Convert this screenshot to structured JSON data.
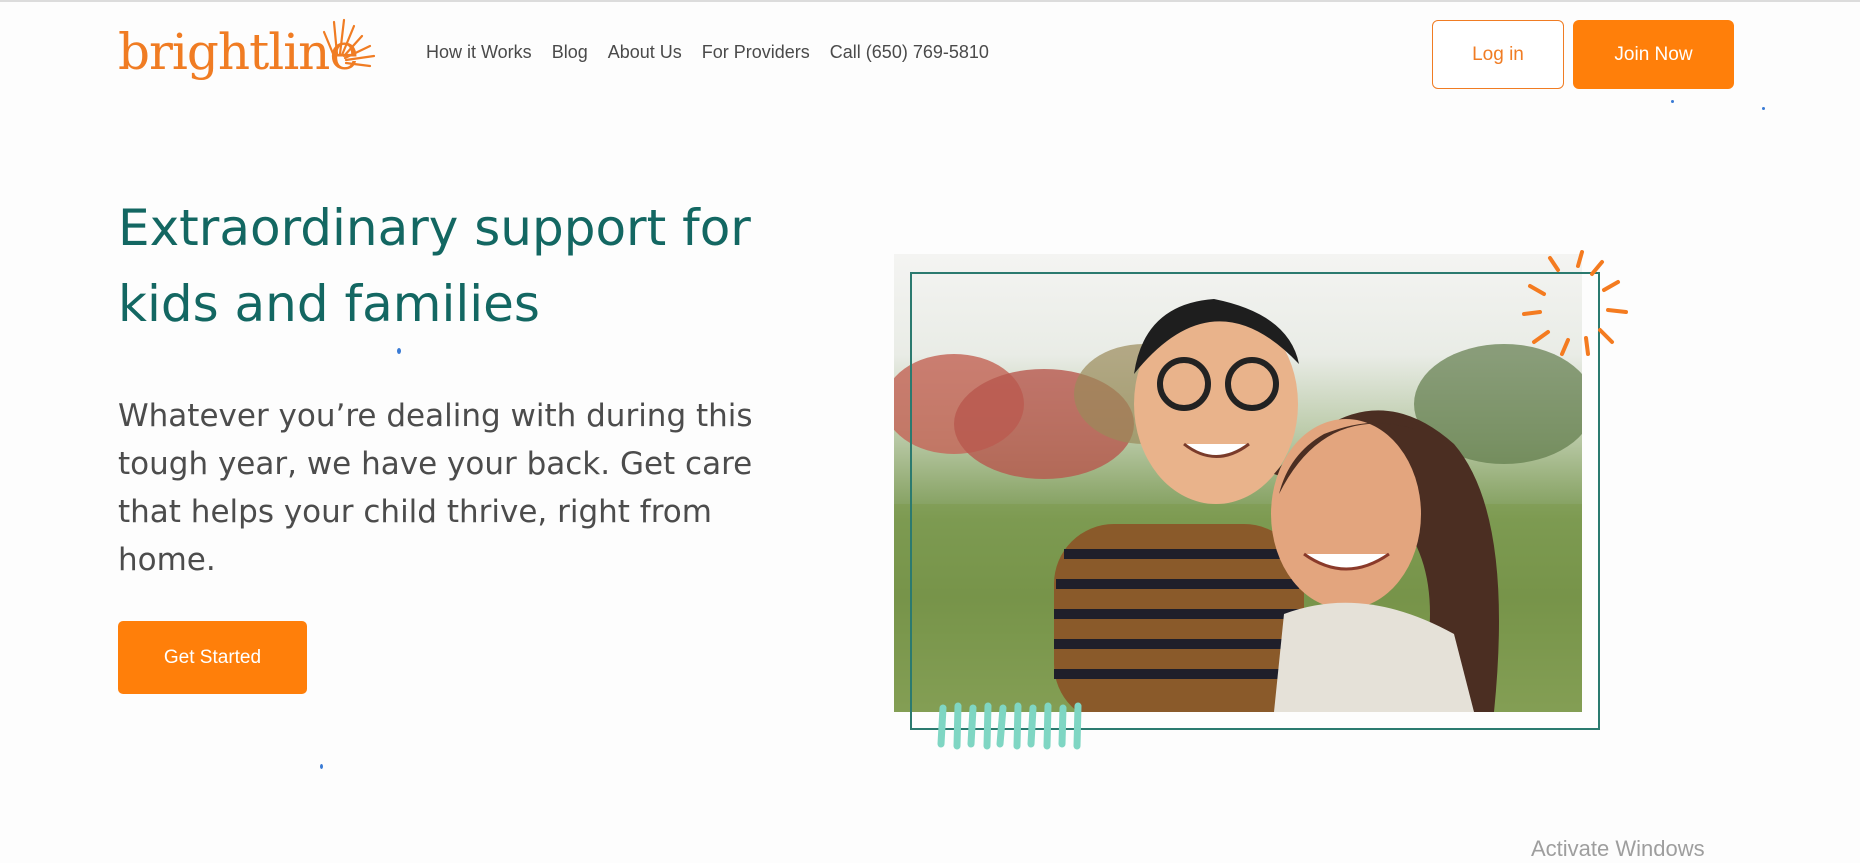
{
  "header": {
    "logo_text": "brightline",
    "nav": [
      "How it Works",
      "Blog",
      "About Us",
      "For Providers",
      "Call (650) 769-5810"
    ],
    "login_label": "Log in",
    "join_label": "Join Now"
  },
  "hero": {
    "title_line1": "Extraordinary support for",
    "title_line2": "kids and families",
    "subtitle": "Whatever you’re dealing with during this tough year, we have your back. Get care that helps your child thrive, right from home.",
    "cta_label": "Get Started"
  },
  "overlay": {
    "activate_windows": "Activate Windows"
  },
  "colors": {
    "brand_orange": "#ff7f0a",
    "logo_orange": "#f07c23",
    "heading_teal": "#136762",
    "frame_teal": "#2b7a6f",
    "accent_mint": "#7fd6c3"
  },
  "icons": [
    "sunburst-logo-icon",
    "orange-burst-icon",
    "mint-ticks-icon"
  ]
}
